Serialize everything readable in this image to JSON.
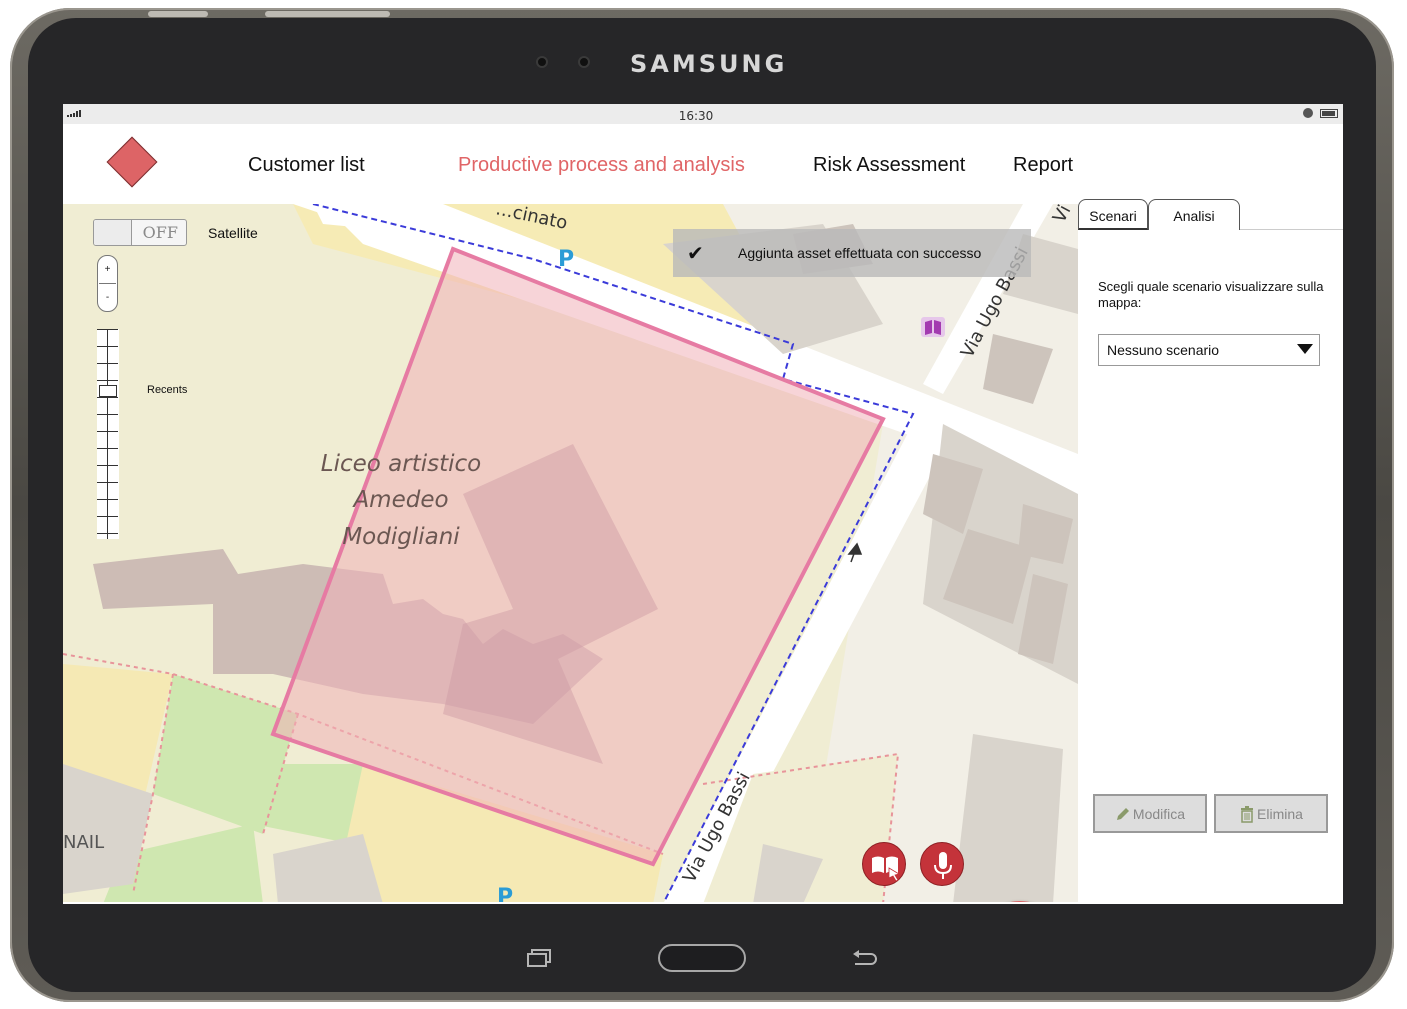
{
  "device": {
    "brand": "SAMSUNG"
  },
  "statusbar": {
    "time": "16:30"
  },
  "nav": {
    "items": [
      {
        "label": "Customer list"
      },
      {
        "label": "Productive process and analysis",
        "active": true
      },
      {
        "label": "Risk Assessment"
      },
      {
        "label": "Report"
      }
    ],
    "active_color": "#e06567",
    "logo_color": "#dd6466"
  },
  "map": {
    "toggle_state": "OFF",
    "toggle_label": "Satellite",
    "zoom_in": "+",
    "zoom_out": "-",
    "slider_label": "Recents",
    "labels": {
      "school_line1": "Liceo artistico",
      "school_line2": "Amedeo",
      "school_line3": "Modigliani",
      "street_top": "Via Ugo Bassi",
      "street_bottom": "Via Ugo Bassi",
      "street_top_partial": "...cinato",
      "street_right_partial": "Vi",
      "bottom_left": "NAIL",
      "parking": "P"
    }
  },
  "toast": {
    "icon": "checkmark-icon",
    "message": "Aggiunta asset effettuata con successo"
  },
  "fabs": {
    "primary_icon": "plus-icon",
    "secondary_icons": [
      "book-touch-icon",
      "microphone-icon"
    ],
    "color": "#c4333a",
    "primary_color": "#dd6466"
  },
  "panel": {
    "tabs": [
      {
        "label": "Scenari",
        "active": true
      },
      {
        "label": "Analisi"
      }
    ],
    "prompt": "Scegli quale scenario visualizzare sulla mappa:",
    "select_value": "Nessuno scenario",
    "buttons": {
      "edit": "Modifica",
      "delete": "Elimina"
    }
  }
}
